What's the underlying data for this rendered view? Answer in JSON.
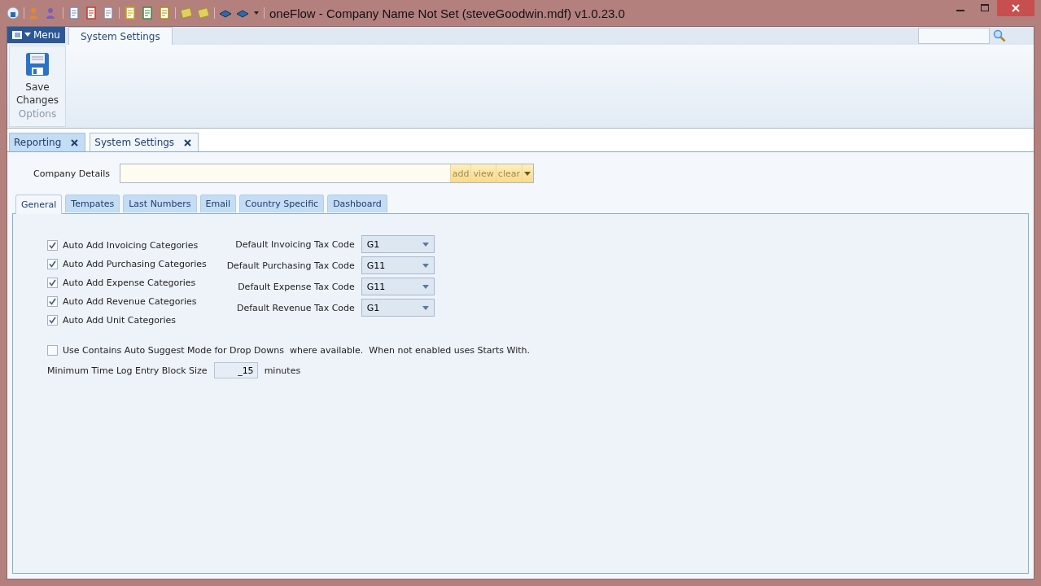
{
  "window": {
    "title": "oneFlow - Company Name Not Set (steveGoodwin.mdf) v1.0.23.0"
  },
  "ribbon": {
    "menu_label": "Menu",
    "tabs": [
      {
        "label": "System Settings",
        "selected": true
      }
    ],
    "groups": [
      {
        "label": "Options",
        "buttons": [
          "Save Changes"
        ]
      }
    ]
  },
  "document_tabs": [
    {
      "label": "Reporting",
      "selected": false
    },
    {
      "label": "System Settings",
      "selected": true
    }
  ],
  "company_details": {
    "label": "Company Details",
    "buttons": [
      "add",
      "view",
      "clear"
    ]
  },
  "settings_tabs": [
    {
      "label": "General",
      "selected": true
    },
    {
      "label": "Tempates",
      "selected": false
    },
    {
      "label": "Last Numbers",
      "selected": false
    },
    {
      "label": "Email",
      "selected": false
    },
    {
      "label": "Country Specific",
      "selected": false
    },
    {
      "label": "Dashboard",
      "selected": false
    }
  ],
  "category_options": [
    {
      "label": "Auto Add Invoicing Categories",
      "checked": true
    },
    {
      "label": "Auto Add Purchasing Categories",
      "checked": true
    },
    {
      "label": "Auto Add Expense Categories",
      "checked": true
    },
    {
      "label": "Auto Add Revenue Categories",
      "checked": true
    },
    {
      "label": "Auto Add Unit Categories",
      "checked": true
    }
  ],
  "tax_codes": [
    {
      "label": "Default Invoicing Tax Code",
      "value": "G1"
    },
    {
      "label": "Default Purchasing Tax Code",
      "value": "G11"
    },
    {
      "label": "Default Expense Tax Code",
      "value": "G11"
    },
    {
      "label": "Default Revenue Tax Code",
      "value": "G1"
    }
  ],
  "auto_suggest": {
    "label": "Use Contains Auto Suggest Mode for Drop Downs  where available.  When not enabled uses Starts With.",
    "checked": false
  },
  "time_log": {
    "label": "Minimum Time Log Entry Block Size",
    "value": "_15",
    "unit": "minutes"
  }
}
